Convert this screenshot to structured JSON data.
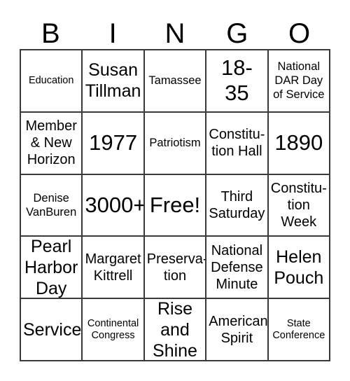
{
  "header": {
    "letters": [
      "B",
      "I",
      "N",
      "G",
      "O"
    ]
  },
  "grid": {
    "rows": 5,
    "columns": 5,
    "border_color": "#3a3a3a",
    "text_color": "#000000",
    "background": "#ffffff",
    "cells": [
      {
        "text": "Education",
        "size": "sm",
        "row": 1,
        "col": 1,
        "column_letter": "B"
      },
      {
        "text": "Susan\nTillman",
        "size": "xl",
        "row": 1,
        "col": 2,
        "column_letter": "I"
      },
      {
        "text": "Tamassee",
        "size": "md",
        "row": 1,
        "col": 3,
        "column_letter": "N"
      },
      {
        "text": "18-\n35",
        "size": "xxl",
        "row": 1,
        "col": 4,
        "column_letter": "G"
      },
      {
        "text": "National\nDAR Day\nof Service",
        "size": "md",
        "row": 1,
        "col": 5,
        "column_letter": "O"
      },
      {
        "text": "Member\n& New\nHorizon",
        "size": "lg",
        "row": 2,
        "col": 1,
        "column_letter": "B"
      },
      {
        "text": "1977",
        "size": "xxl",
        "row": 2,
        "col": 2,
        "column_letter": "I"
      },
      {
        "text": "Patriotism",
        "size": "md",
        "row": 2,
        "col": 3,
        "column_letter": "N"
      },
      {
        "text": "Constitu-\ntion Hall",
        "size": "lg",
        "row": 2,
        "col": 4,
        "column_letter": "G"
      },
      {
        "text": "1890",
        "size": "xxl",
        "row": 2,
        "col": 5,
        "column_letter": "O"
      },
      {
        "text": "Denise\nVanBuren",
        "size": "md",
        "row": 3,
        "col": 1,
        "column_letter": "B"
      },
      {
        "text": "3000+",
        "size": "xxl",
        "row": 3,
        "col": 2,
        "column_letter": "I"
      },
      {
        "text": "Free!",
        "size": "xxl",
        "row": 3,
        "col": 3,
        "column_letter": "N"
      },
      {
        "text": "Third\nSaturday",
        "size": "lg",
        "row": 3,
        "col": 4,
        "column_letter": "G"
      },
      {
        "text": "Constitu-\ntion\nWeek",
        "size": "lg",
        "row": 3,
        "col": 5,
        "column_letter": "O"
      },
      {
        "text": "Pearl\nHarbor\nDay",
        "size": "xl",
        "row": 4,
        "col": 1,
        "column_letter": "B"
      },
      {
        "text": "Margaret\nKittrell",
        "size": "lg",
        "row": 4,
        "col": 2,
        "column_letter": "I"
      },
      {
        "text": "Preserva-\ntion",
        "size": "lg",
        "row": 4,
        "col": 3,
        "column_letter": "N"
      },
      {
        "text": "National\nDefense\nMinute",
        "size": "lg",
        "row": 4,
        "col": 4,
        "column_letter": "G"
      },
      {
        "text": "Helen\nPouch",
        "size": "xl",
        "row": 4,
        "col": 5,
        "column_letter": "O"
      },
      {
        "text": "Service",
        "size": "xl",
        "row": 5,
        "col": 1,
        "column_letter": "B"
      },
      {
        "text": "Continental\nCongress",
        "size": "sm",
        "row": 5,
        "col": 2,
        "column_letter": "I"
      },
      {
        "text": "Rise\nand\nShine",
        "size": "xl",
        "row": 5,
        "col": 3,
        "column_letter": "N"
      },
      {
        "text": "American\nSpirit",
        "size": "lg",
        "row": 5,
        "col": 4,
        "column_letter": "G"
      },
      {
        "text": "State\nConference",
        "size": "sm",
        "row": 5,
        "col": 5,
        "column_letter": "O"
      }
    ]
  }
}
